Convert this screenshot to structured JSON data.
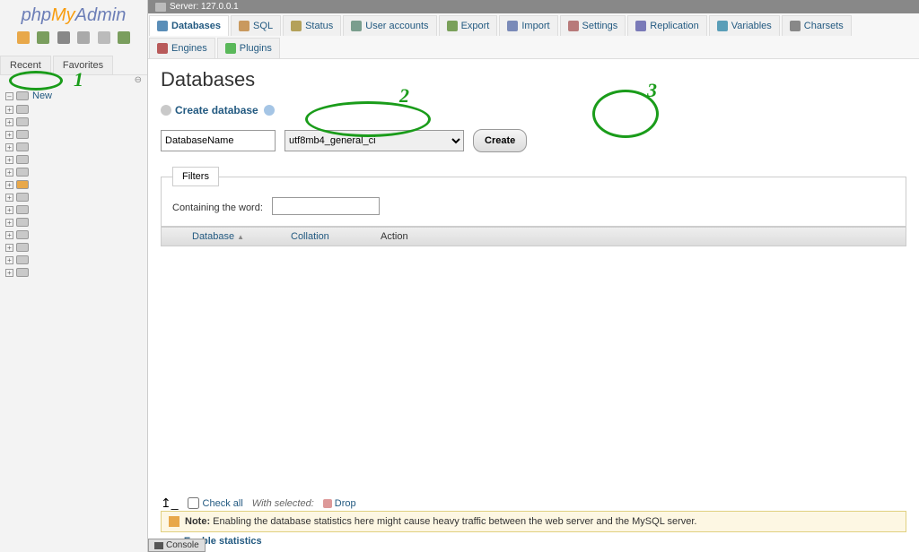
{
  "logo": {
    "p1": "php",
    "p2": "My",
    "p3": "Admin"
  },
  "sidebar_tabs": {
    "recent": "Recent",
    "favorites": "Favorites"
  },
  "tree": {
    "new": "New"
  },
  "breadcrumb": {
    "server": "Server: 127.0.0.1"
  },
  "menu": {
    "databases": "Databases",
    "sql": "SQL",
    "status": "Status",
    "users": "User accounts",
    "export": "Export",
    "import": "Import",
    "settings": "Settings",
    "replication": "Replication",
    "variables": "Variables",
    "charsets": "Charsets",
    "engines": "Engines",
    "plugins": "Plugins"
  },
  "page": {
    "title": "Databases",
    "create_label": "Create database",
    "dbname_value": "DatabaseName",
    "collation_value": "utf8mb4_general_ci",
    "create_btn": "Create"
  },
  "filters": {
    "legend": "Filters",
    "label": "Containing the word:"
  },
  "table": {
    "database": "Database",
    "collation": "Collation",
    "action": "Action"
  },
  "footer": {
    "checkall": "Check all",
    "withsel": "With selected:",
    "drop": "Drop"
  },
  "notice": {
    "label": "Note:",
    "text": "Enabling the database statistics here might cause heavy traffic between the web server and the MySQL server."
  },
  "enable": "Enable statistics",
  "console": "Console",
  "anno": {
    "n1": "1",
    "n2": "2",
    "n3": "3"
  }
}
